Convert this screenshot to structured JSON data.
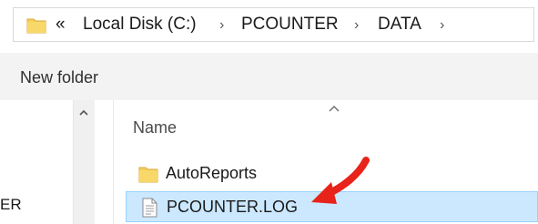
{
  "address": {
    "overflow_chevron": "«",
    "crumbs": [
      "Local Disk (C:)",
      "PCOUNTER",
      "DATA"
    ],
    "separator": "›"
  },
  "toolbar": {
    "new_folder_label": "New folder"
  },
  "nav_pane": {
    "partial_item": "ER"
  },
  "file_list": {
    "column_name": "Name",
    "items": [
      {
        "name": "AutoReports",
        "icon": "folder-icon",
        "selected": false
      },
      {
        "name": "PCOUNTER.LOG",
        "icon": "text-file-icon",
        "selected": true
      }
    ]
  },
  "colors": {
    "folder_yellow": "#f6cf5b",
    "selection_bg": "#cce8ff",
    "selection_border": "#99d1ff",
    "annotation_arrow": "#e8231a"
  }
}
